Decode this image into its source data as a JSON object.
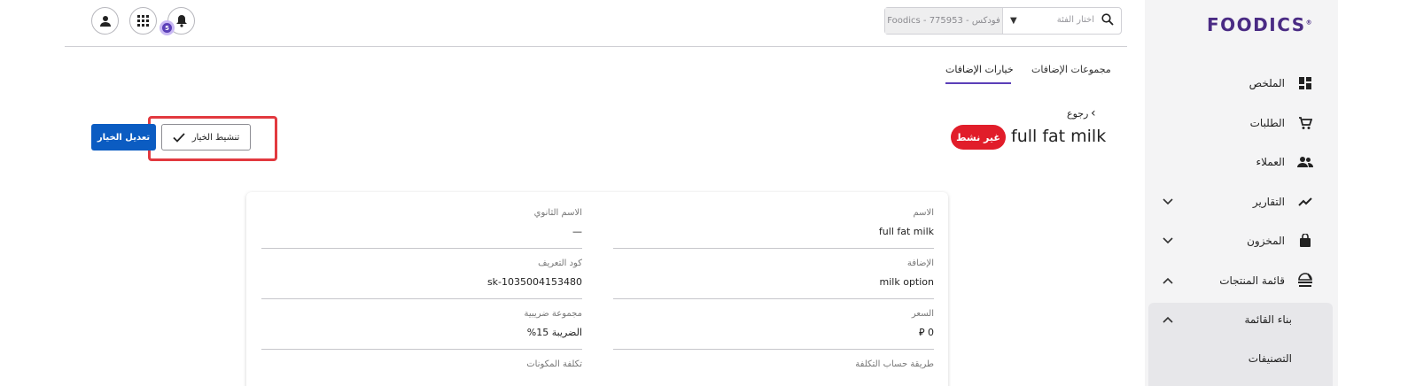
{
  "brand": {
    "logo_text": "FOODICS",
    "trademark": "®"
  },
  "sidebar": {
    "items": [
      {
        "label": "الملخص",
        "icon": "dashboard-icon"
      },
      {
        "label": "الطلبات",
        "icon": "cart-icon"
      },
      {
        "label": "العملاء",
        "icon": "customers-icon"
      },
      {
        "label": "التقارير",
        "icon": "reports-icon",
        "chevron": "⌄"
      },
      {
        "label": "المخزون",
        "icon": "inventory-icon",
        "chevron": "⌄"
      },
      {
        "label": "قائمة المنتجات",
        "icon": "menu-icon",
        "chevron": "⌃"
      }
    ],
    "sub_items": [
      {
        "label": "بناء القائمة",
        "chevron": "⌃"
      },
      {
        "label": "التصنيفات"
      }
    ]
  },
  "topbar": {
    "branch_value": "Foodics - فودكس - 775953",
    "branch_placeholder": "اختار الفئة",
    "notification_count": "5"
  },
  "tabs": [
    {
      "label": "خيارات الإضافات",
      "active": true
    },
    {
      "label": "مجموعات الإضافات",
      "active": false
    }
  ],
  "header": {
    "back_label": "رجوع",
    "title": "full fat milk",
    "status": "غير نشط",
    "activate_label": "تنشيط الخيار",
    "edit_label": "تعديل الخيار"
  },
  "details": {
    "name_label": "الاسم",
    "name_value": "full fat milk",
    "secondary_name_label": "الاسم الثانوي",
    "secondary_name_value": "—",
    "modifier_label": "الإضافة",
    "modifier_value": "milk option",
    "sku_label": "كود التعريف",
    "sku_value": "sk-1035004153480",
    "price_label": "السعر",
    "price_value": "0 ⃁",
    "tax_group_label": "مجموعة ضريبية",
    "tax_group_value": "الضريبة 15%",
    "costing_method_label": "طريقة حساب التكلفة",
    "ingredients_cost_label": "تكلفة المكونات"
  },
  "colors": {
    "accent": "#5b3fb8",
    "danger": "#e11d2a",
    "primary": "#0b5cc2",
    "highlight": "#e2393f"
  }
}
